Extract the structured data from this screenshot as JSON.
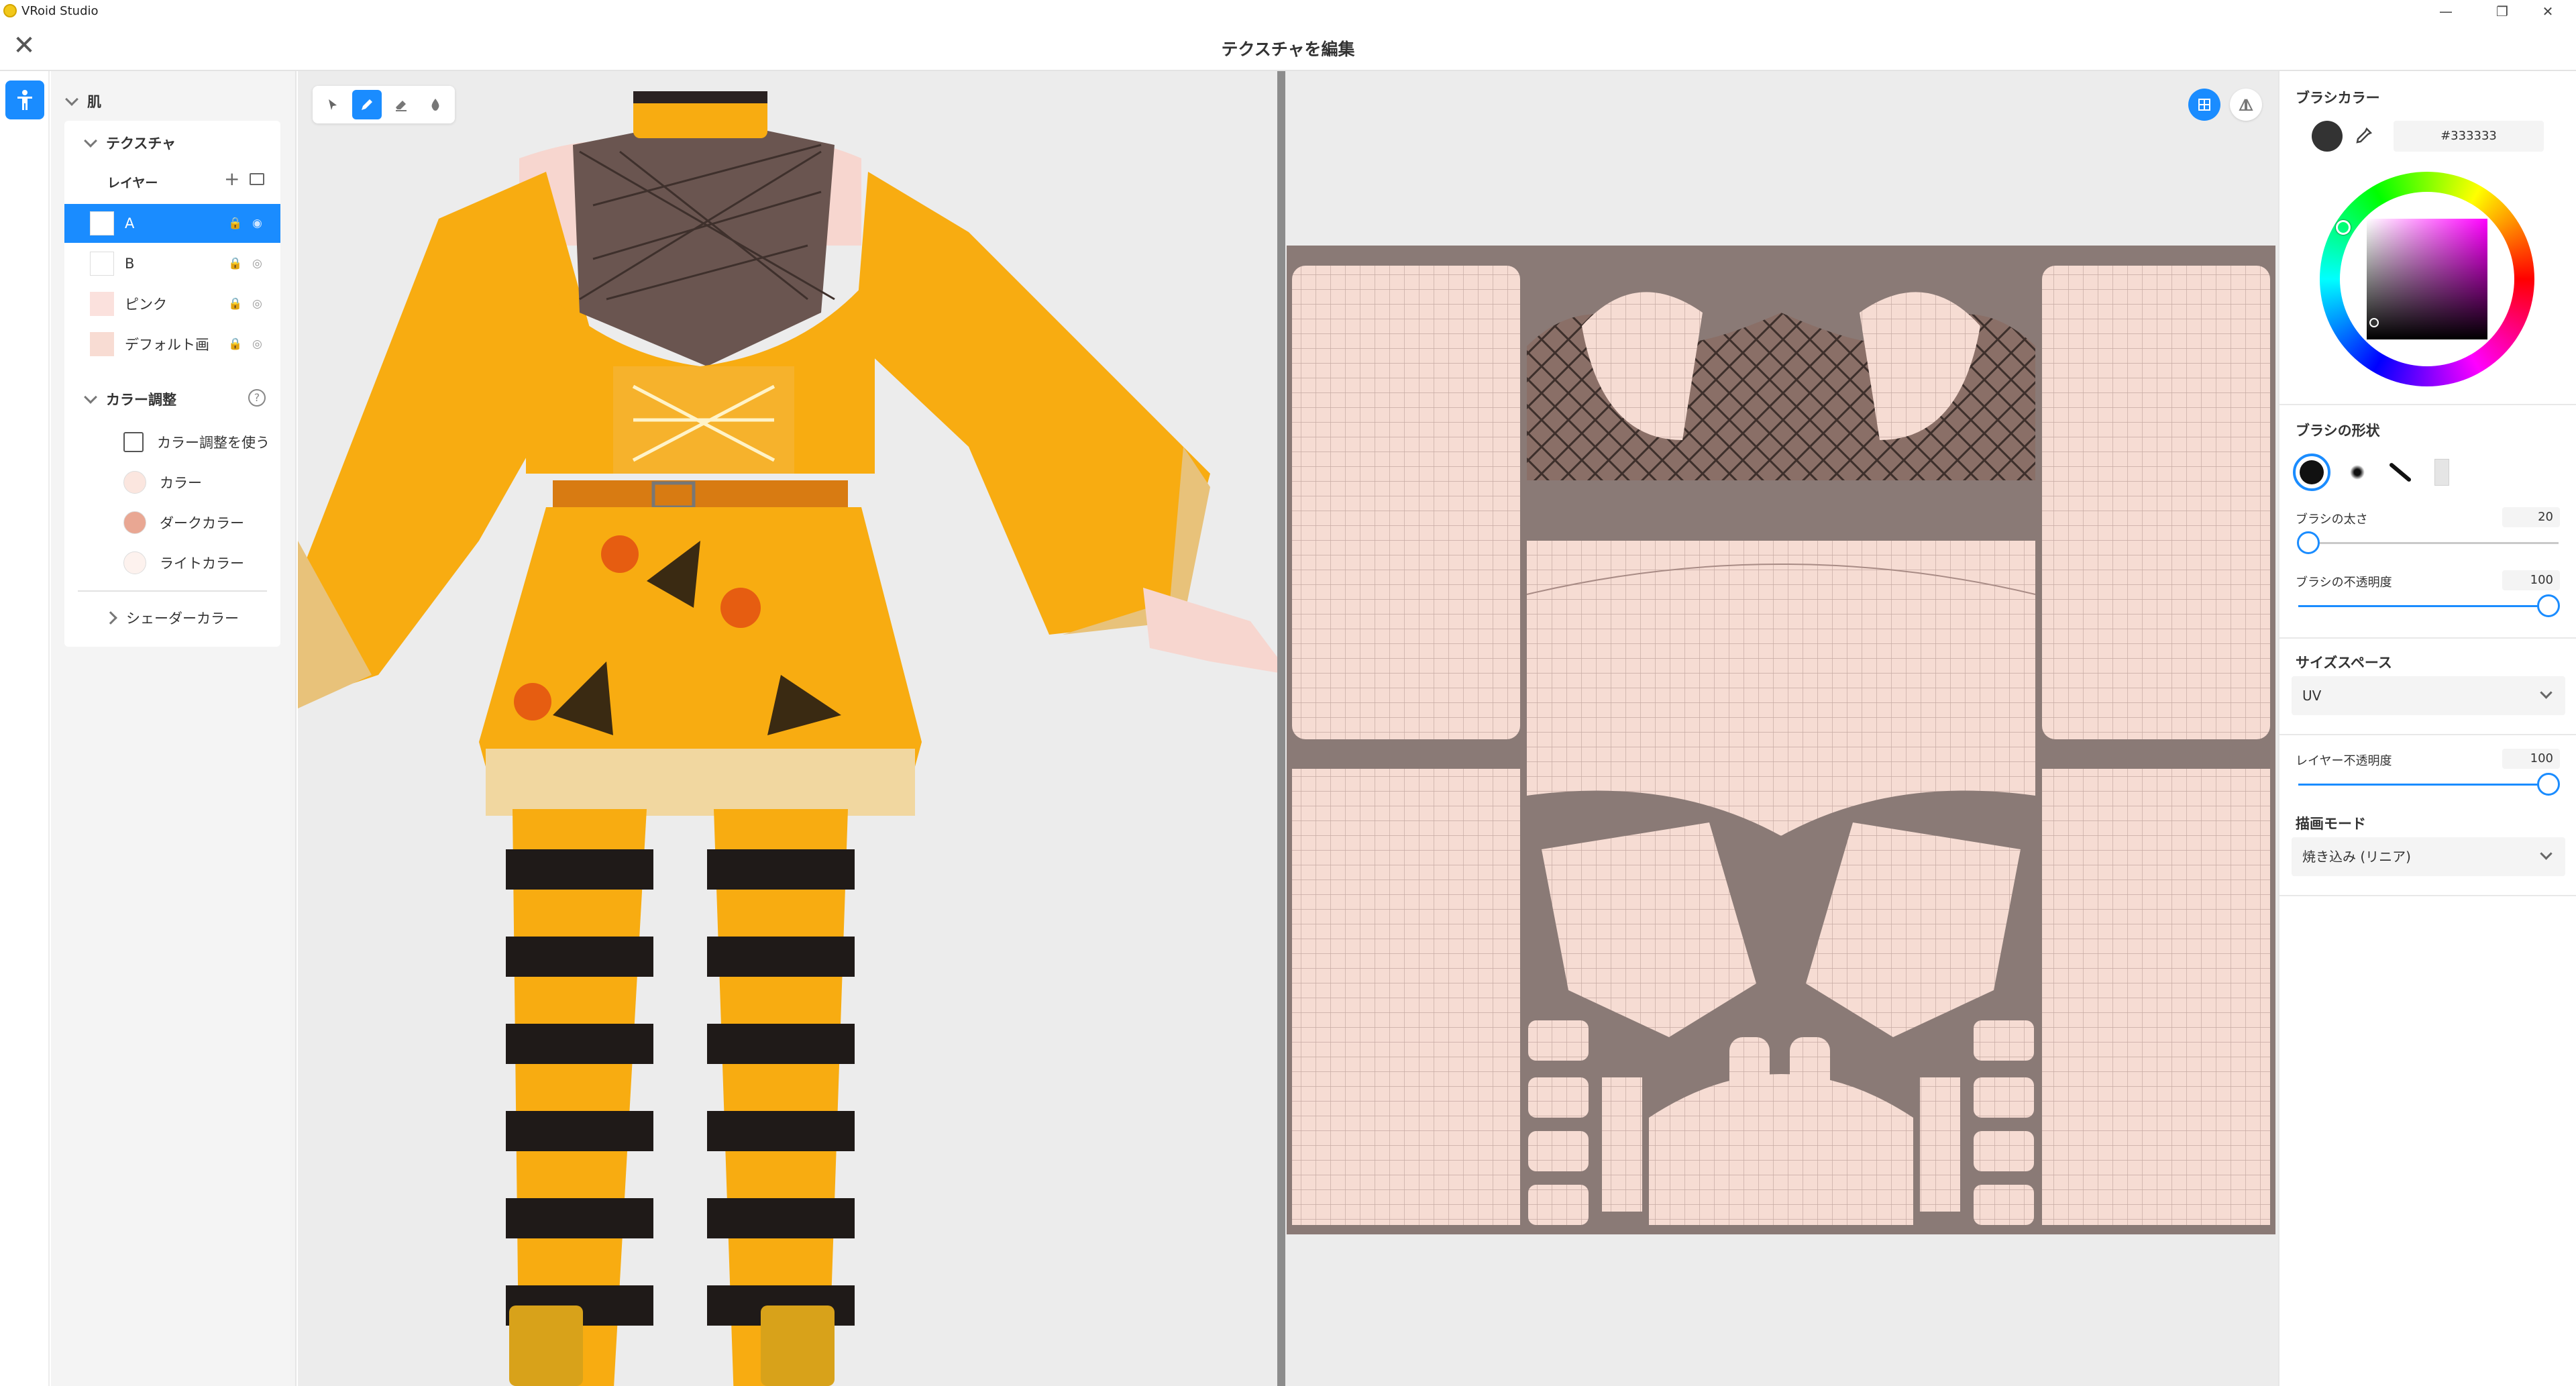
{
  "app": {
    "title": "VRoid Studio",
    "window_controls": [
      "—",
      "❐",
      "✕"
    ]
  },
  "header": {
    "title": "テクスチャを編集",
    "close_label": "✕"
  },
  "left_panel": {
    "section": "肌",
    "texture_group": "テクスチャ",
    "layer_header": "レイヤー",
    "add_symbol": "+",
    "layers": [
      {
        "name": "A",
        "active": true
      },
      {
        "name": "B",
        "active": false
      },
      {
        "name": "ピンク",
        "active": false,
        "swatch": "#fbe1dd"
      },
      {
        "name": "デフォルト画",
        "active": false,
        "swatch": "#f8dcd3"
      }
    ],
    "color_adjust": {
      "title": "カラー調整",
      "help": "?",
      "checkbox_label": "カラー調整を使う",
      "items": [
        {
          "label": "カラー",
          "color": "#fbe6df"
        },
        {
          "label": "ダークカラー",
          "color": "#e9a793"
        },
        {
          "label": "ライトカラー",
          "color": "#fdf2ee"
        }
      ]
    },
    "shader_color": "シェーダーカラー"
  },
  "right_panel": {
    "brush_color_title": "ブラシカラー",
    "brush_color": "#333333",
    "brush_color_hex": "#333333",
    "brush_shape_title": "ブラシの形状",
    "brush_size_label": "ブラシの太さ",
    "brush_size_value": "20",
    "brush_size_fraction": 0.04,
    "brush_opacity_label": "ブラシの不透明度",
    "brush_opacity_value": "100",
    "brush_opacity_fraction": 1.0,
    "size_space_title": "サイズスペース",
    "size_space_value": "UV",
    "layer_opacity_label": "レイヤー不透明度",
    "layer_opacity_value": "100",
    "layer_opacity_fraction": 1.0,
    "draw_mode_title": "描画モード",
    "draw_mode_value": "焼き込み (リニア)"
  },
  "colors": {
    "accent": "#1a8cff",
    "skin": "#f6dcd3",
    "uv_bg": "#8a7a76",
    "orange": "#f8ac11"
  }
}
